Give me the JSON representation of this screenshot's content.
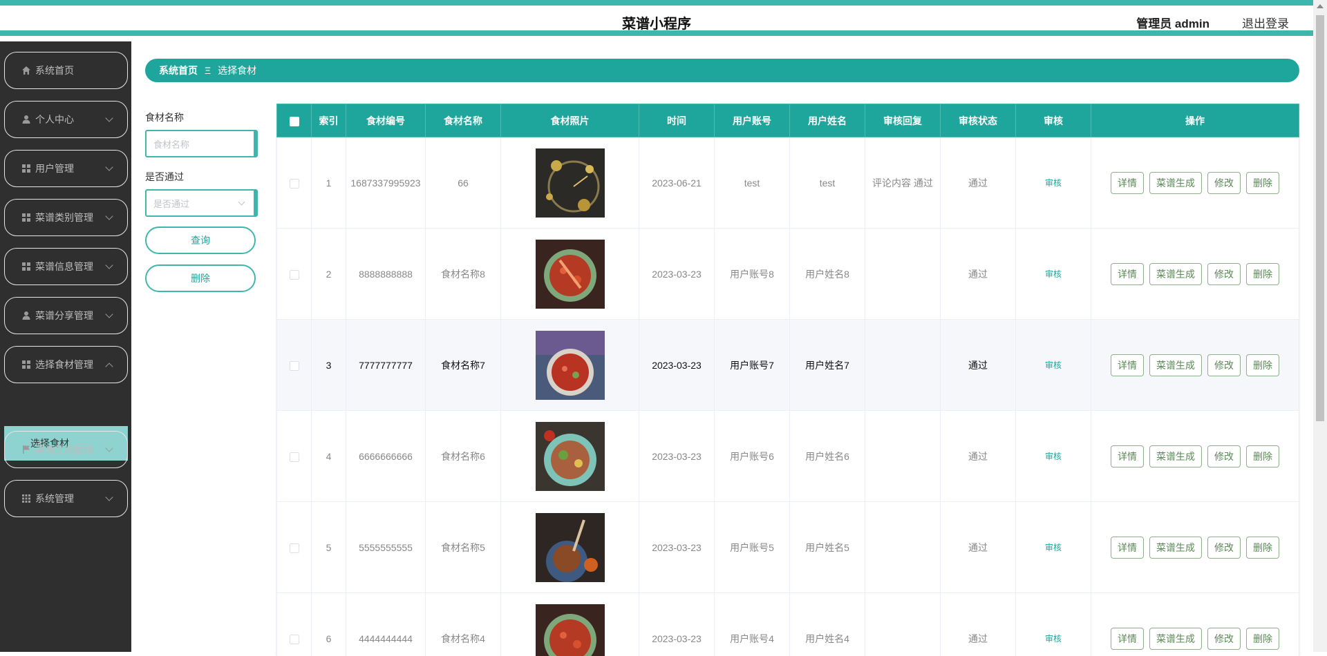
{
  "header": {
    "title": "菜谱小程序",
    "user": "管理员 admin",
    "logout": "退出登录"
  },
  "sidebar": {
    "items": [
      {
        "label": "系统首页",
        "icon": "home-icon"
      },
      {
        "label": "个人中心",
        "icon": "person-icon"
      },
      {
        "label": "用户管理",
        "icon": "grid-icon"
      },
      {
        "label": "菜谱类别管理",
        "icon": "grid-icon"
      },
      {
        "label": "菜谱信息管理",
        "icon": "grid-icon"
      },
      {
        "label": "菜谱分享管理",
        "icon": "person-icon"
      },
      {
        "label": "选择食材管理",
        "icon": "grid-icon"
      },
      {
        "label": "菜谱生成管理",
        "icon": "flag-icon"
      },
      {
        "label": "系统管理",
        "icon": "apps-icon"
      }
    ],
    "active_sub": "选择食材"
  },
  "breadcrumb": {
    "home": "系统首页",
    "separator": "Ξ",
    "current": "选择食材"
  },
  "filters": {
    "name_label": "食材名称",
    "name_placeholder": "食材名称",
    "pass_label": "是否通过",
    "pass_placeholder": "是否通过",
    "query_button": "查询",
    "delete_button": "删除"
  },
  "table": {
    "headers": [
      "索引",
      "食材编号",
      "食材名称",
      "食材照片",
      "时间",
      "用户账号",
      "用户姓名",
      "审核回复",
      "审核状态",
      "审核",
      "操作"
    ],
    "audit_label": "审核",
    "ops": [
      "详情",
      "菜谱生成",
      "修改",
      "删除"
    ],
    "rows": [
      {
        "index": "1",
        "code": "1687337995923",
        "name": "66",
        "time": "2023-06-21",
        "account": "test",
        "username": "test",
        "reply": "评论内容 通过",
        "status": "通过"
      },
      {
        "index": "2",
        "code": "8888888888",
        "name": "食材名称8",
        "time": "2023-03-23",
        "account": "用户账号8",
        "username": "用户姓名8",
        "reply": "",
        "status": "通过"
      },
      {
        "index": "3",
        "code": "7777777777",
        "name": "食材名称7",
        "time": "2023-03-23",
        "account": "用户账号7",
        "username": "用户姓名7",
        "reply": "",
        "status": "通过"
      },
      {
        "index": "4",
        "code": "6666666666",
        "name": "食材名称6",
        "time": "2023-03-23",
        "account": "用户账号6",
        "username": "用户姓名6",
        "reply": "",
        "status": "通过"
      },
      {
        "index": "5",
        "code": "5555555555",
        "name": "食材名称5",
        "time": "2023-03-23",
        "account": "用户账号5",
        "username": "用户姓名5",
        "reply": "",
        "status": "通过"
      },
      {
        "index": "6",
        "code": "4444444444",
        "name": "食材名称4",
        "time": "2023-03-23",
        "account": "用户账号4",
        "username": "用户姓名4",
        "reply": "",
        "status": "通过"
      }
    ]
  },
  "colors": {
    "accent": "#1fa69c",
    "sidebar_bg": "#2f2f2f",
    "submenu_bg": "#8ed3cf",
    "op_button": "#5b8a57"
  }
}
